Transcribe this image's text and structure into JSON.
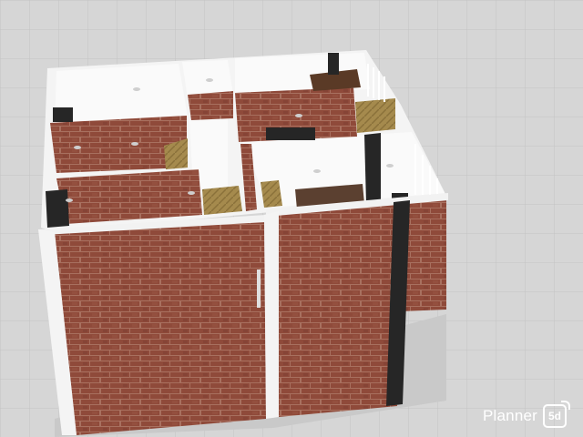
{
  "app": {
    "watermark_text": "Planner",
    "watermark_badge": "5d"
  },
  "view": {
    "mode": "3D",
    "floor_grid": true
  },
  "colors": {
    "floor": "#d6d6d6",
    "grid_line": "#c6c6c6",
    "brick": "#8f4a3a",
    "brick_mortar": "#a8705f",
    "wall_top": "#f4f4f4",
    "room_floor": "#fafafa",
    "dark_frame": "#262626",
    "wood": "#a58a4d"
  },
  "icons": {
    "watermark": "planner5d-logo-icon"
  }
}
